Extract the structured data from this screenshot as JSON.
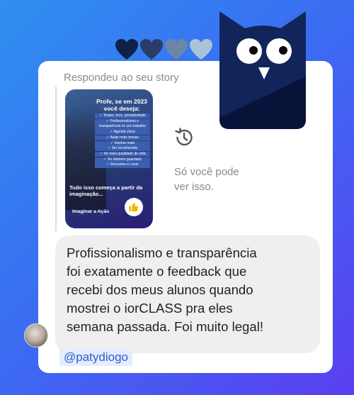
{
  "header": {
    "replied_label": "Respondeu ao seu story"
  },
  "hearts": {
    "count": 4,
    "colors": [
      "#0f2147",
      "#2b3c68",
      "#6c86a8",
      "#aac3d6"
    ]
  },
  "story": {
    "title_lines": [
      "Profe, se em 2023",
      "você deseja:"
    ],
    "list_items": [
      "✓ Tempo, foco, produtividade",
      "✓ Profissionalismo e",
      "transparência no seu trabalho",
      "✓ Agenda cheia",
      "✓ Aulas mais tensas",
      "✓ Ganhar mais",
      "✓ Ser reconhecida",
      "✓ Ter mais qualidade de vida",
      "✓ Ter dinheiro guardado",
      "✓ Descanso e Lazer"
    ],
    "tagline_lines": [
      "Tudo isso começa a partir da",
      "imaginação..."
    ],
    "brand": "Imaginar a Ação",
    "like_icon": "thumbs-up-icon"
  },
  "notice": {
    "lines": [
      "Só você pode",
      "ver isso."
    ],
    "icon": "history-icon"
  },
  "message": {
    "lines": [
      "Profissionalismo e transparência",
      "foi exatamente o feedback que",
      "recebi dos meus alunos quando",
      "mostrei o iorCLASS pra eles",
      "semana passada. Foi muito legal!"
    ]
  },
  "sender": {
    "handle": "@patydiogo"
  },
  "owl": {
    "icon": "owl-logo-icon",
    "colors": {
      "body": "#12255a",
      "shade": "#071338",
      "eye": "#ffffff",
      "pupil": "#0a0a0a",
      "beak": "#ffffff"
    }
  }
}
